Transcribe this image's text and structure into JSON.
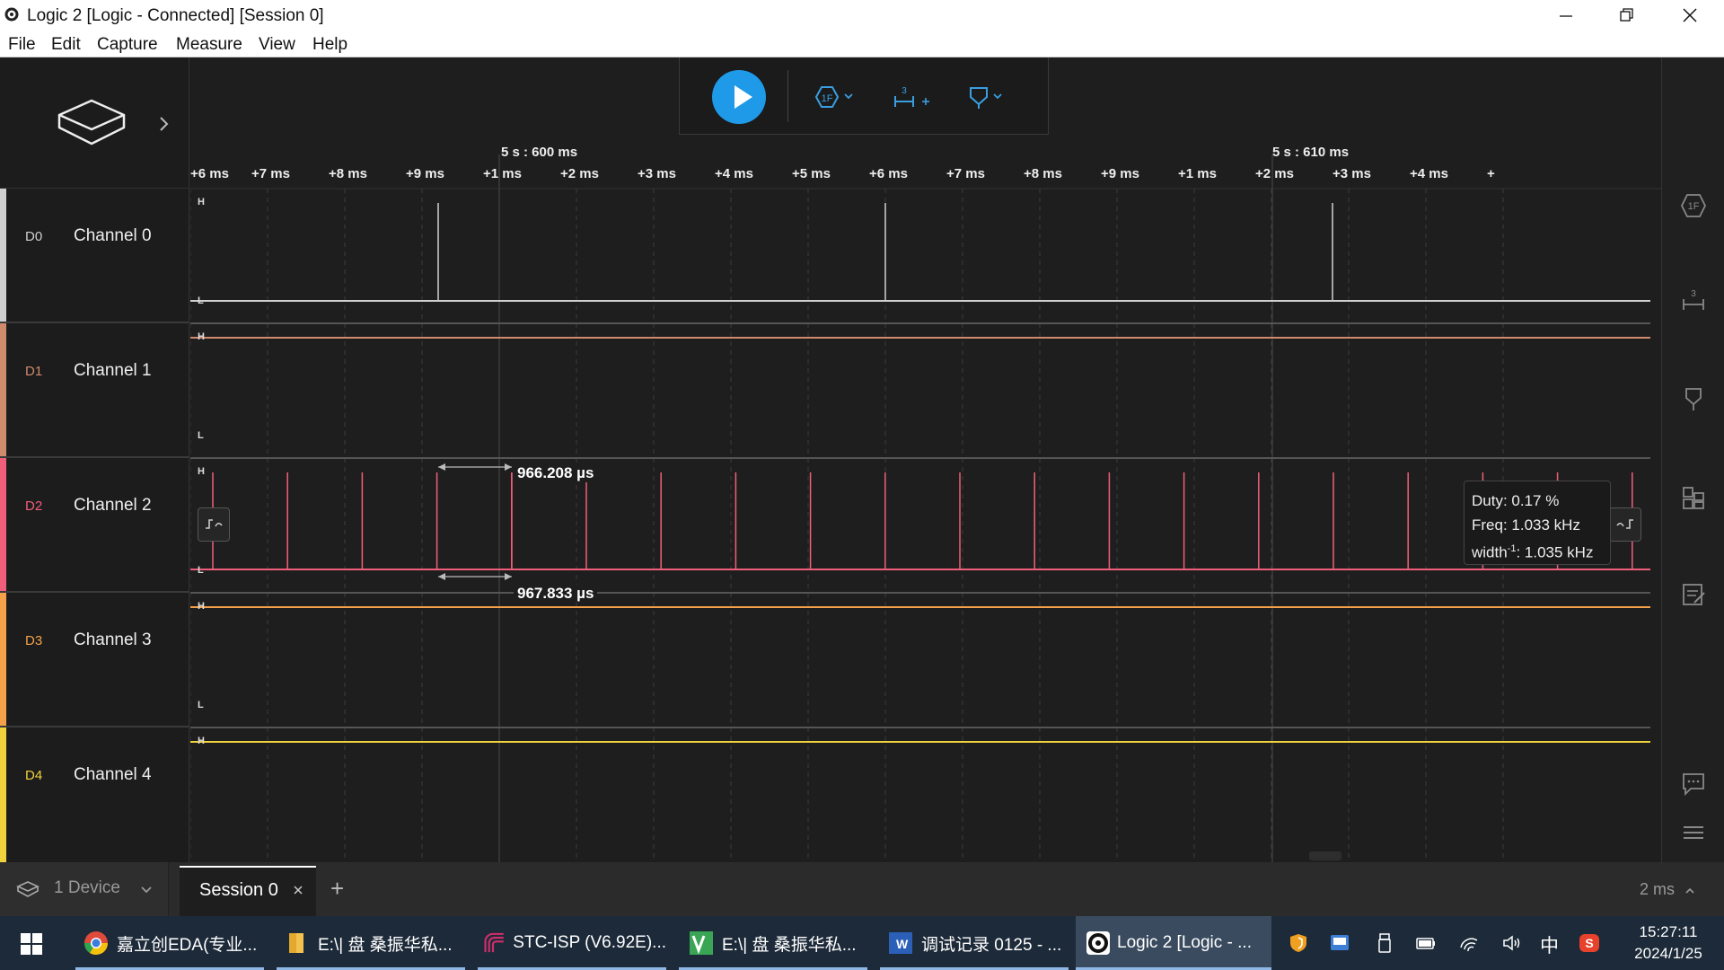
{
  "titlebar": {
    "title": "Logic 2 [Logic - Connected] [Session 0]"
  },
  "menu": [
    "File",
    "Edit",
    "Capture",
    "Measure",
    "View",
    "Help"
  ],
  "ruler": {
    "major_labels": [
      "5 s : 600 ms",
      "5 s : 610 ms"
    ],
    "ticks": [
      "+6 ms",
      "+7 ms",
      "+8 ms",
      "+9 ms",
      "+1 ms",
      "+2 ms",
      "+3 ms",
      "+4 ms",
      "+5 ms",
      "+6 ms",
      "+7 ms",
      "+8 ms",
      "+9 ms",
      "+1 ms",
      "+2 ms",
      "+3 ms",
      "+4 ms",
      "+"
    ]
  },
  "channels": [
    {
      "code": "D0",
      "name": "Channel 0",
      "color": "#d0d0d0"
    },
    {
      "code": "D1",
      "name": "Channel 1",
      "color": "#d08a6c"
    },
    {
      "code": "D2",
      "name": "Channel 2",
      "color": "#f05f7a"
    },
    {
      "code": "D3",
      "name": "Channel 3",
      "color": "#f5a14a"
    },
    {
      "code": "D4",
      "name": "Channel 4",
      "color": "#f0d23c"
    }
  ],
  "levels": {
    "high": "H",
    "low": "L"
  },
  "measurements": {
    "top": "966.208 µs",
    "bottom": "967.833 µs"
  },
  "tooltip": {
    "duty": "Duty: 0.17 %",
    "freq": "Freq: 1.033 kHz",
    "width_prefix": "width",
    "width_sup": "-1",
    "width_value": ": 1.035 kHz"
  },
  "toolbar": {
    "trigger_icon": "1F",
    "measure_badge": "3"
  },
  "session": {
    "device_tab": "1 Device",
    "session_tab": "Session 0",
    "add": "+",
    "timescale": "2 ms"
  },
  "taskbar": {
    "items": [
      {
        "label": "嘉立创EDA(专业...",
        "icon": "chrome-icon"
      },
      {
        "label": "E:\\| 盘 桑振华私...",
        "icon": "folder-icon"
      },
      {
        "label": "STC-ISP (V6.92E)...",
        "icon": "stc-icon"
      },
      {
        "label": "E:\\| 盘 桑振华私...",
        "icon": "vs-icon"
      },
      {
        "label": "调试记录 0125 - ...",
        "icon": "word-icon"
      },
      {
        "label": "Logic 2 [Logic - ...",
        "icon": "logic-icon"
      }
    ],
    "ime": "中",
    "time": "15:27:11",
    "date": "2024/1/25"
  }
}
